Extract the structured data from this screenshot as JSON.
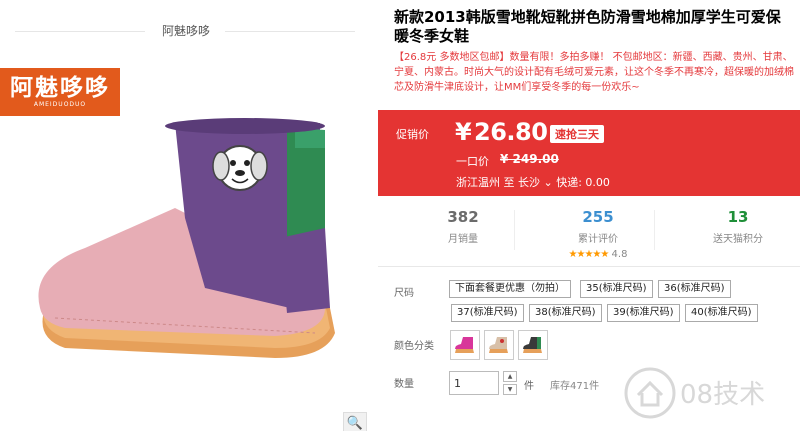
{
  "shop": {
    "name": "阿魅哆哆"
  },
  "brand_logo": {
    "text": "阿魅哆哆",
    "subtext": "AMEIDUODUO"
  },
  "product": {
    "title": "新款2013韩版雪地靴短靴拼色防滑雪地棉加厚学生可爱保暖冬季女鞋",
    "subtitle": "【26.8元 多数地区包邮】数量有限！多拍多赚！ 不包邮地区：新疆、西藏、贵州、甘肃、宁夏、内蒙古。时尚大气的设计配有毛绒可爱元素，让这个冬季不再寒冷，超保暖的加绒棉芯及防滑牛津底设计，让MM们享受冬季的每一份欢乐~"
  },
  "price": {
    "label": "促销价",
    "currency": "¥",
    "value": "26.80",
    "tag": "速抢三天",
    "orig_label": "一口价",
    "orig_value": "¥ 249.00",
    "ship_from": "浙江温州",
    "ship_to_word": "至",
    "ship_to": "长沙",
    "delivery": "快递: 0.00"
  },
  "stats": {
    "sales": {
      "value": "382",
      "label": "月销量"
    },
    "reviews": {
      "value": "255",
      "label": "累计评价",
      "rating": "4.8",
      "stars": "★★★★★"
    },
    "points": {
      "value": "13",
      "label": "送天猫积分"
    }
  },
  "sizes": {
    "label": "尺码",
    "options": [
      "下面套餐更优惠（勿拍）",
      "35(标准尺码)",
      "36(标准尺码)",
      "37(标准尺码)",
      "38(标准尺码)",
      "39(标准尺码)",
      "40(标准尺码)"
    ]
  },
  "colors": {
    "label": "颜色分类"
  },
  "quantity": {
    "label": "数量",
    "value": "1",
    "unit": "件",
    "stock": "库存471件"
  },
  "watermark": {
    "text": "08技术"
  },
  "colors_palette": {
    "price_bg": "#e43433",
    "brand": "#e25a1c",
    "reviews": "#3c8fd0",
    "points": "#1f8f38"
  }
}
